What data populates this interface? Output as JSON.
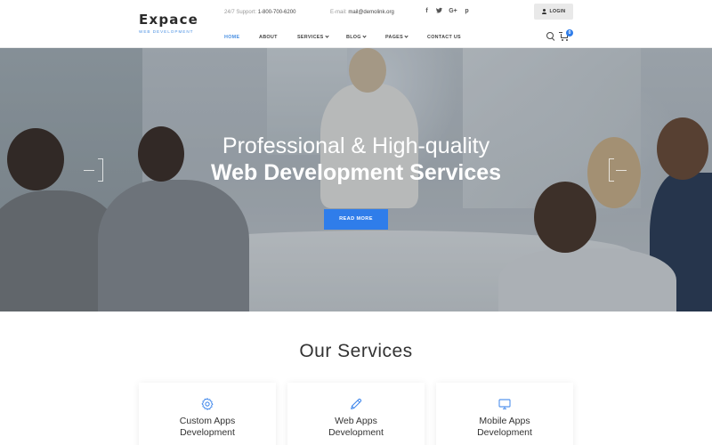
{
  "brand": {
    "name": "Expace",
    "tagline": "WEB DEVELOPMENT"
  },
  "topbar": {
    "support_label": "24/7 Support:",
    "support_value": "1-800-700-6200",
    "email_label": "E-mail:",
    "email_value": "mail@demolink.org",
    "social": [
      "f",
      "t",
      "G+",
      "p"
    ],
    "login_label": "LOGIN"
  },
  "nav": {
    "items": [
      {
        "label": "HOME",
        "active": true
      },
      {
        "label": "ABOUT"
      },
      {
        "label": "SERVICES",
        "dropdown": true
      },
      {
        "label": "BLOG",
        "dropdown": true
      },
      {
        "label": "PAGES",
        "dropdown": true
      },
      {
        "label": "CONTACT US"
      }
    ],
    "cart_count": "0"
  },
  "hero": {
    "title": "Professional & High-quality",
    "subtitle": "Web Development Services",
    "button_label": "READ MORE"
  },
  "services": {
    "title": "Our Services",
    "cards": [
      {
        "line1": "Custom Apps",
        "line2": "Development",
        "icon": "gear-icon"
      },
      {
        "line1": "Web Apps",
        "line2": "Development",
        "icon": "pencil-icon"
      },
      {
        "line1": "Mobile Apps",
        "line2": "Development",
        "icon": "monitor-icon"
      }
    ]
  },
  "colors": {
    "accent": "#2f7dea",
    "nav_active": "#4a90e2"
  }
}
